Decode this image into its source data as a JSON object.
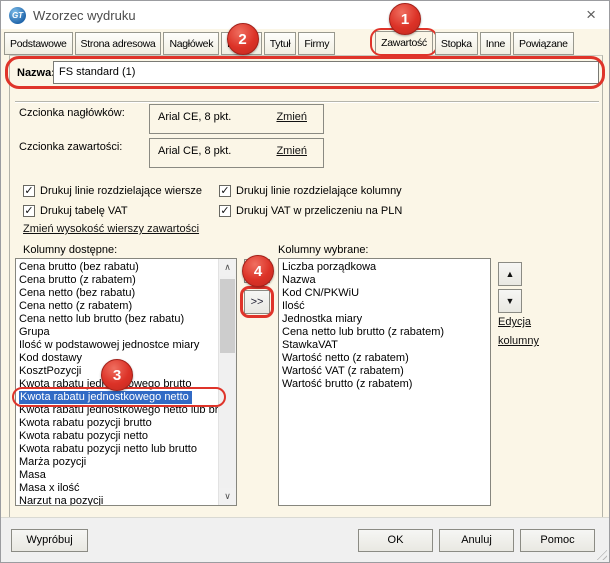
{
  "window": {
    "title": "Wzorzec wydruku",
    "icon_text": "GT",
    "close_glyph": "×"
  },
  "tabs": [
    {
      "label": "Podstawowe"
    },
    {
      "label": "Strona adresowa"
    },
    {
      "label": "Nagłówek"
    },
    {
      "label": "Papier"
    },
    {
      "label": "Tytuł"
    },
    {
      "label": "Firmy"
    },
    {
      "label": "Zawartość",
      "active": true
    },
    {
      "label": "Stopka"
    },
    {
      "label": "Inne"
    },
    {
      "label": "Powiązane"
    }
  ],
  "name_row": {
    "label": "Nazwa:",
    "value": "FS standard (1)"
  },
  "fonts": {
    "header_label": "Czcionka nagłówków:",
    "header_value": "Arial CE, 8 pkt.",
    "content_label": "Czcionka zawartości:",
    "content_value": "Arial CE, 8 pkt.",
    "change_label": "Zmień"
  },
  "checkboxes": [
    {
      "label": "Drukuj linie rozdzielające wiersze",
      "checked": true
    },
    {
      "label": "Drukuj linie rozdzielające kolumny",
      "checked": true
    },
    {
      "label": "Drukuj tabelę VAT",
      "checked": true
    },
    {
      "label": "Drukuj VAT w przeliczeniu na PLN",
      "checked": true
    }
  ],
  "row_height_link": "Zmień wysokość wierszy zawartości",
  "columns": {
    "available_label": "Kolumny dostępne:",
    "available": [
      "Cena brutto (bez rabatu)",
      "Cena brutto (z rabatem)",
      "Cena netto (bez rabatu)",
      "Cena netto (z rabatem)",
      "Cena netto lub brutto (bez rabatu)",
      "Grupa",
      "Ilość w podstawowej jednostce miary",
      "Kod dostawy",
      "KosztPozycji",
      "Kwota rabatu jednostkowego brutto",
      "Kwota rabatu jednostkowego netto",
      "Kwota rabatu jednostkowego netto lub brutto",
      "Kwota rabatu pozycji brutto",
      "Kwota rabatu pozycji netto",
      "Kwota rabatu pozycji netto lub brutto",
      "Marża pozycji",
      "Masa",
      "Masa x ilość",
      "Narzut na pozycji"
    ],
    "selected_index": 10,
    "selection_color": "#316AC5",
    "chosen_label": "Kolumny wybrane:",
    "chosen": [
      "Liczba porządkowa",
      "Nazwa",
      "Kod CN/PKWiU",
      "Ilość",
      "Jednostka miary",
      "Cena netto lub brutto (z rabatem)",
      "StawkaVAT",
      "Wartość netto (z rabatem)",
      "Wartość VAT (z rabatem)",
      "Wartość brutto (z rabatem)"
    ]
  },
  "transfer": {
    "add_all_label": ">>"
  },
  "edit_column_link": {
    "line1": "Edycja",
    "line2": "kolumny"
  },
  "icons": {
    "move_up": "▲",
    "move_down": "▼",
    "scroll_up": "∧",
    "scroll_down": "∨",
    "check": "✓"
  },
  "buttons": {
    "try": "Wypróbuj",
    "ok": "OK",
    "cancel": "Anuluj",
    "help": "Pomoc"
  },
  "annotations": {
    "badges": [
      "1",
      "2",
      "3",
      "4"
    ],
    "color": "#DF342A",
    "ringed_tab": "Zawartość",
    "badge2_tab": "Papier"
  }
}
